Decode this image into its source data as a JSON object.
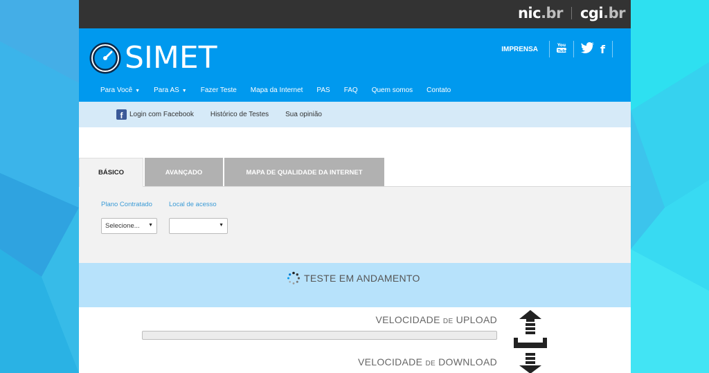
{
  "topbar": {
    "logo_nic": "nic",
    "logo_nic_suffix": ".br",
    "logo_cgi": "cgi",
    "logo_cgi_suffix": ".br"
  },
  "header": {
    "logo_text": "SIMET",
    "imprensa": "IMPRENSA",
    "nav": [
      {
        "label": "Para Você"
      },
      {
        "label": "Para AS"
      },
      {
        "label": "Fazer Teste"
      },
      {
        "label": "Mapa da Internet"
      },
      {
        "label": "PAS"
      },
      {
        "label": "FAQ"
      },
      {
        "label": "Quem somos"
      },
      {
        "label": "Contato"
      }
    ]
  },
  "subnav": {
    "login": "Login com Facebook",
    "history": "Histórico de Testes",
    "opinion": "Sua opinião"
  },
  "tabs": {
    "basico": "BÁSICO",
    "avancado": "AVANÇADO",
    "mapa": "MAPA DE QUALIDADE DA INTERNET"
  },
  "form": {
    "plano_label": "Plano Contratado",
    "plano_value": "Selecione...",
    "local_label": "Local de acesso",
    "local_value": ""
  },
  "status": {
    "text": "TESTE EM ANDAMENTO"
  },
  "speed": {
    "upload_prefix": "VELOCIDADE",
    "upload_de": "DE",
    "upload_word": "UPLOAD",
    "upload_progress": 0,
    "download_prefix": "VELOCIDADE",
    "download_de": "DE",
    "download_word": "DOWNLOAD"
  },
  "colors": {
    "brand_blue": "#0099ee",
    "background": "#32c6e6"
  }
}
